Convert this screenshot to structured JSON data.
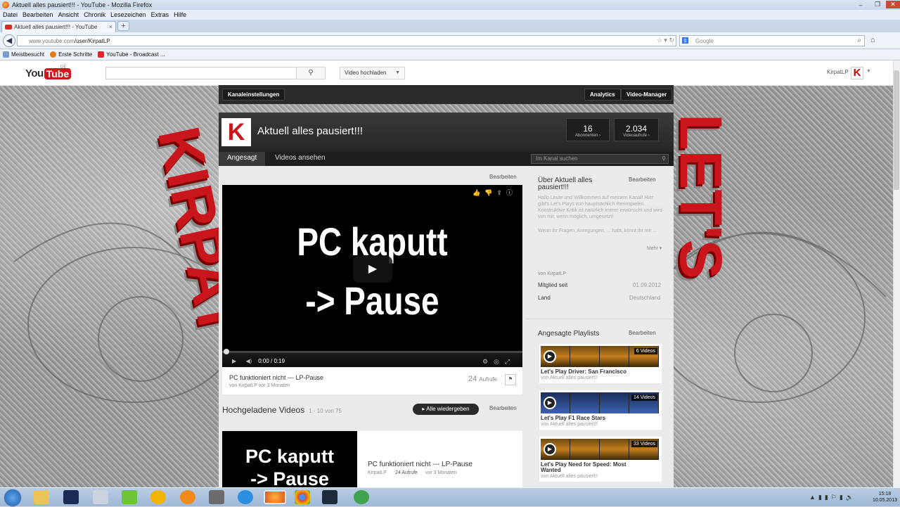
{
  "browser": {
    "window_title": "Aktuell alles pausiert!!! - YouTube - Mozilla Firefox",
    "menu": [
      "Datei",
      "Bearbeiten",
      "Ansicht",
      "Chronik",
      "Lesezeichen",
      "Extras",
      "Hilfe"
    ],
    "tab_title": "Aktuell alles pausiert!!! - YouTube",
    "new_tab": "+",
    "url_host": "www.youtube.com",
    "url_path": "/user/KirpatLP",
    "search_placeholder": "Google",
    "bookmarks": [
      "Meistbesucht",
      "Erste Schritte",
      "YouTube - Broadcast ..."
    ]
  },
  "youtube_header": {
    "logo_you": "You",
    "logo_tube": "Tube",
    "logo_region": "DE",
    "upload_label": "Video hochladen",
    "username": "KirpatLP"
  },
  "channel_bar": {
    "settings": "Kanaleinstellungen",
    "analytics": "Analytics",
    "video_manager": "Video-Manager"
  },
  "channel": {
    "title": "Aktuell alles pausiert!!!",
    "subscribers_count": "16",
    "subscribers_label": "Abonnenten ›",
    "views_count": "2.034",
    "views_label": "Videoaufrufe ›",
    "tabs": [
      "Angesagt",
      "Videos ansehen"
    ],
    "search_placeholder": "Im Kanal suchen"
  },
  "featured": {
    "edit": "Bearbeiten",
    "video_line1": "PC kaputt",
    "video_line2": "-> Pause",
    "time": "0:00 / 0:19",
    "title": "PC funktioniert nicht --- LP-Pause",
    "byline": "von KirpatLP vor 3 Monaten",
    "views_num": "24",
    "views_label": "Aufrufe"
  },
  "uploaded": {
    "heading": "Hochgeladene Videos",
    "range": "1 - 10 von 75",
    "play_all": "▸ Alle wiedergeben",
    "edit": "Bearbeiten",
    "card_line1": "PC kaputt",
    "card_line2": "-> Pause",
    "card_title": "PC funktioniert nicht --- LP-Pause",
    "card_author": "KirpatLP",
    "card_views": "24 Aufrufe",
    "card_age": "vor 3 Monaten"
  },
  "about": {
    "heading": "Über Aktuell alles pausiert!!!",
    "edit": "Bearbeiten",
    "description": "Hallo Leute und Willkommen auf meinem Kanal! Hier gibt's Let's Plays von hauptsächlich Rennspielen. Konstruktive Kritik ist natürlich immer erwünscht und wird von mir, wenn möglich, umgesetzt!",
    "description2": "Wenn ihr Fragen, Anregungen, ... habt, könnt ihr mir ...",
    "more": "Mehr ▾",
    "from": "von KirpatLP",
    "member_label": "Mitglied seit",
    "member_value": "01.09.2012",
    "country_label": "Land",
    "country_value": "Deutschland"
  },
  "playlists": {
    "heading": "Angesagte Playlists",
    "edit": "Bearbeiten",
    "items": [
      {
        "title": "Let's Play Driver: San Francisco",
        "count": "6 Videos",
        "sub": "von Aktuell alles pausiert!!"
      },
      {
        "title": "Let's Play F1 Race Stars",
        "count": "14 Videos",
        "sub": "von Aktuell alles pausiert!!"
      },
      {
        "title": "Let's Play Need for Speed: Most Wanted",
        "count": "33 Videos",
        "sub": "von Aktuell alles pausiert!!"
      }
    ]
  },
  "background_art": {
    "left_text": "KIRPAT",
    "right_text": "LET'S PLAY"
  },
  "taskbar": {
    "time": "15:18",
    "date": "10.05.2013"
  }
}
